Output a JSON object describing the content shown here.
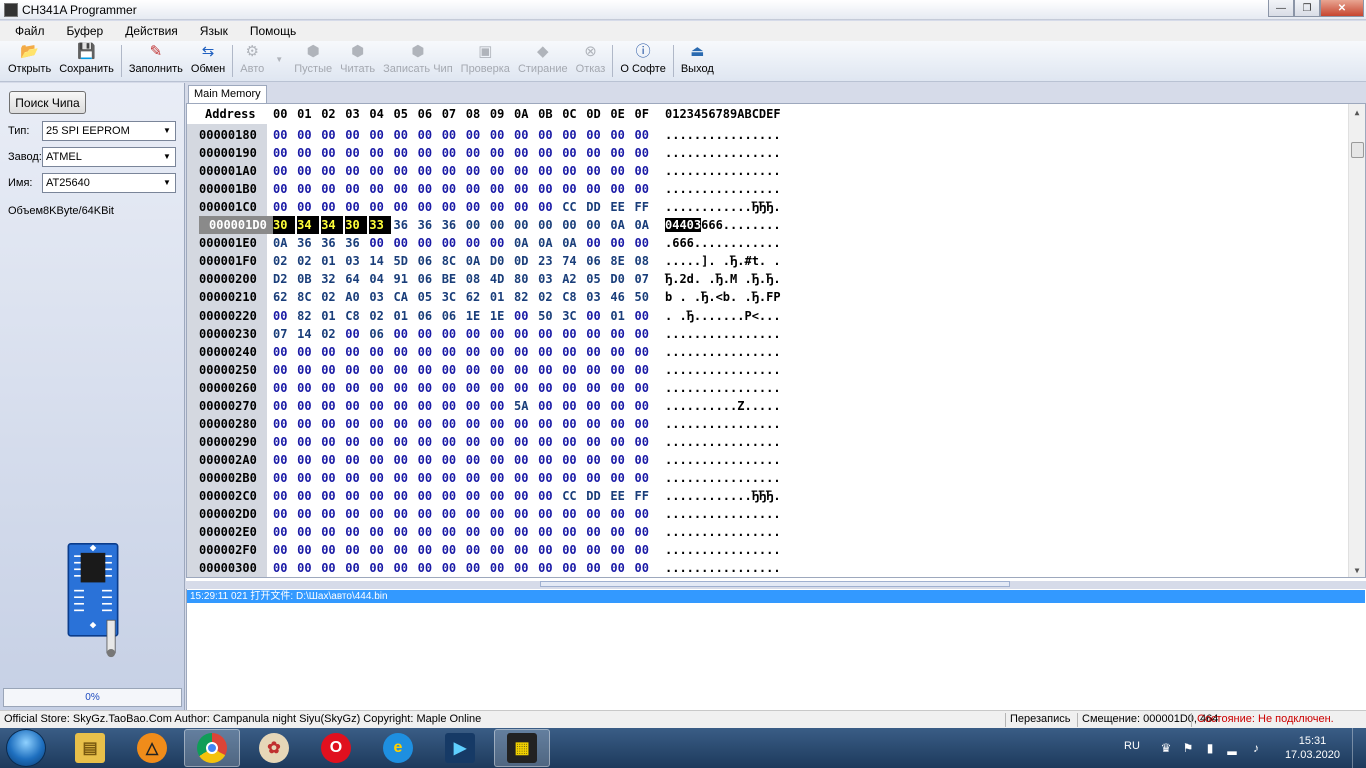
{
  "window": {
    "title": "CH341A Programmer",
    "minimize_label": "—",
    "maximize_label": "❐",
    "close_label": "✕"
  },
  "menu": {
    "items": [
      "Файл",
      "Буфер",
      "Действия",
      "Язык",
      "Помощь"
    ]
  },
  "toolbar": {
    "open": "Открыть",
    "save": "Сохранить",
    "fill": "Заполнить",
    "swap": "Обмен",
    "auto": "Авто",
    "blank": "Пустые",
    "read": "Читать",
    "write": "Записать Чип",
    "verify": "Проверка",
    "erase": "Стирание",
    "cancel": "Отказ",
    "about": "О Софте",
    "exit": "Выход"
  },
  "left_panel": {
    "search_button": "Поиск Чипа",
    "type_label": "Тип:",
    "type_value": "25 SPI EEPROM",
    "vendor_label": "Завод:",
    "vendor_value": "ATMEL",
    "name_label": "Имя:",
    "name_value": "AT25640",
    "capacity": "Объем8KByte/64KBit",
    "progress": "0%"
  },
  "hex": {
    "tab": "Main Memory",
    "address_header": "Address",
    "column_headers": [
      "00",
      "01",
      "02",
      "03",
      "04",
      "05",
      "06",
      "07",
      "08",
      "09",
      "0A",
      "0B",
      "0C",
      "0D",
      "0E",
      "0F"
    ],
    "ascii_header": "0123456789ABCDEF",
    "rows": [
      {
        "addr": "00000180",
        "bytes": [
          "00",
          "00",
          "00",
          "00",
          "00",
          "00",
          "00",
          "00",
          "00",
          "00",
          "00",
          "00",
          "00",
          "00",
          "00",
          "00"
        ],
        "ascii": "................"
      },
      {
        "addr": "00000190",
        "bytes": [
          "00",
          "00",
          "00",
          "00",
          "00",
          "00",
          "00",
          "00",
          "00",
          "00",
          "00",
          "00",
          "00",
          "00",
          "00",
          "00"
        ],
        "ascii": "................"
      },
      {
        "addr": "000001A0",
        "bytes": [
          "00",
          "00",
          "00",
          "00",
          "00",
          "00",
          "00",
          "00",
          "00",
          "00",
          "00",
          "00",
          "00",
          "00",
          "00",
          "00"
        ],
        "ascii": "................"
      },
      {
        "addr": "000001B0",
        "bytes": [
          "00",
          "00",
          "00",
          "00",
          "00",
          "00",
          "00",
          "00",
          "00",
          "00",
          "00",
          "00",
          "00",
          "00",
          "00",
          "00"
        ],
        "ascii": "................"
      },
      {
        "addr": "000001C0",
        "bytes": [
          "00",
          "00",
          "00",
          "00",
          "00",
          "00",
          "00",
          "00",
          "00",
          "00",
          "00",
          "00",
          "CC",
          "DD",
          "EE",
          "FF"
        ],
        "ascii": "............ЂЂЂ."
      },
      {
        "addr": "000001D0",
        "bytes": [
          "30",
          "34",
          "34",
          "30",
          "33",
          "36",
          "36",
          "36",
          "00",
          "00",
          "00",
          "00",
          "00",
          "00",
          "0A",
          "0A"
        ],
        "ascii": "04403666........",
        "selected": true
      },
      {
        "addr": "000001E0",
        "bytes": [
          "0A",
          "36",
          "36",
          "36",
          "00",
          "00",
          "00",
          "00",
          "00",
          "00",
          "0A",
          "0A",
          "0A",
          "00",
          "00",
          "00"
        ],
        "ascii": ".666............"
      },
      {
        "addr": "000001F0",
        "bytes": [
          "02",
          "02",
          "01",
          "03",
          "14",
          "5D",
          "06",
          "8C",
          "0A",
          "D0",
          "0D",
          "23",
          "74",
          "06",
          "8E",
          "08"
        ],
        "ascii": ".....]. .Ђ.#t. ."
      },
      {
        "addr": "00000200",
        "bytes": [
          "D2",
          "0B",
          "32",
          "64",
          "04",
          "91",
          "06",
          "BE",
          "08",
          "4D",
          "80",
          "03",
          "A2",
          "05",
          "D0",
          "07"
        ],
        "ascii": "Ђ.2d. .Ђ.M .Ђ.Ђ."
      },
      {
        "addr": "00000210",
        "bytes": [
          "62",
          "8C",
          "02",
          "A0",
          "03",
          "CA",
          "05",
          "3C",
          "62",
          "01",
          "82",
          "02",
          "C8",
          "03",
          "46",
          "50"
        ],
        "ascii": "b . .Ђ.<b. .Ђ.FP"
      },
      {
        "addr": "00000220",
        "bytes": [
          "00",
          "82",
          "01",
          "C8",
          "02",
          "01",
          "06",
          "06",
          "1E",
          "1E",
          "00",
          "50",
          "3C",
          "00",
          "01",
          "00"
        ],
        "ascii": ". .Ђ.......P<..."
      },
      {
        "addr": "00000230",
        "bytes": [
          "07",
          "14",
          "02",
          "00",
          "06",
          "00",
          "00",
          "00",
          "00",
          "00",
          "00",
          "00",
          "00",
          "00",
          "00",
          "00"
        ],
        "ascii": "................"
      },
      {
        "addr": "00000240",
        "bytes": [
          "00",
          "00",
          "00",
          "00",
          "00",
          "00",
          "00",
          "00",
          "00",
          "00",
          "00",
          "00",
          "00",
          "00",
          "00",
          "00"
        ],
        "ascii": "................"
      },
      {
        "addr": "00000250",
        "bytes": [
          "00",
          "00",
          "00",
          "00",
          "00",
          "00",
          "00",
          "00",
          "00",
          "00",
          "00",
          "00",
          "00",
          "00",
          "00",
          "00"
        ],
        "ascii": "................"
      },
      {
        "addr": "00000260",
        "bytes": [
          "00",
          "00",
          "00",
          "00",
          "00",
          "00",
          "00",
          "00",
          "00",
          "00",
          "00",
          "00",
          "00",
          "00",
          "00",
          "00"
        ],
        "ascii": "................"
      },
      {
        "addr": "00000270",
        "bytes": [
          "00",
          "00",
          "00",
          "00",
          "00",
          "00",
          "00",
          "00",
          "00",
          "00",
          "5A",
          "00",
          "00",
          "00",
          "00",
          "00"
        ],
        "ascii": "..........Z....."
      },
      {
        "addr": "00000280",
        "bytes": [
          "00",
          "00",
          "00",
          "00",
          "00",
          "00",
          "00",
          "00",
          "00",
          "00",
          "00",
          "00",
          "00",
          "00",
          "00",
          "00"
        ],
        "ascii": "................"
      },
      {
        "addr": "00000290",
        "bytes": [
          "00",
          "00",
          "00",
          "00",
          "00",
          "00",
          "00",
          "00",
          "00",
          "00",
          "00",
          "00",
          "00",
          "00",
          "00",
          "00"
        ],
        "ascii": "................"
      },
      {
        "addr": "000002A0",
        "bytes": [
          "00",
          "00",
          "00",
          "00",
          "00",
          "00",
          "00",
          "00",
          "00",
          "00",
          "00",
          "00",
          "00",
          "00",
          "00",
          "00"
        ],
        "ascii": "................"
      },
      {
        "addr": "000002B0",
        "bytes": [
          "00",
          "00",
          "00",
          "00",
          "00",
          "00",
          "00",
          "00",
          "00",
          "00",
          "00",
          "00",
          "00",
          "00",
          "00",
          "00"
        ],
        "ascii": "................"
      },
      {
        "addr": "000002C0",
        "bytes": [
          "00",
          "00",
          "00",
          "00",
          "00",
          "00",
          "00",
          "00",
          "00",
          "00",
          "00",
          "00",
          "CC",
          "DD",
          "EE",
          "FF"
        ],
        "ascii": "............ЂЂЂ."
      },
      {
        "addr": "000002D0",
        "bytes": [
          "00",
          "00",
          "00",
          "00",
          "00",
          "00",
          "00",
          "00",
          "00",
          "00",
          "00",
          "00",
          "00",
          "00",
          "00",
          "00"
        ],
        "ascii": "................"
      },
      {
        "addr": "000002E0",
        "bytes": [
          "00",
          "00",
          "00",
          "00",
          "00",
          "00",
          "00",
          "00",
          "00",
          "00",
          "00",
          "00",
          "00",
          "00",
          "00",
          "00"
        ],
        "ascii": "................"
      },
      {
        "addr": "000002F0",
        "bytes": [
          "00",
          "00",
          "00",
          "00",
          "00",
          "00",
          "00",
          "00",
          "00",
          "00",
          "00",
          "00",
          "00",
          "00",
          "00",
          "00"
        ],
        "ascii": "................"
      },
      {
        "addr": "00000300",
        "bytes": [
          "00",
          "00",
          "00",
          "00",
          "00",
          "00",
          "00",
          "00",
          "00",
          "00",
          "00",
          "00",
          "00",
          "00",
          "00",
          "00"
        ],
        "ascii": "................"
      }
    ],
    "selected_ascii_prefix": "04403"
  },
  "log": {
    "line": "15:29:11 021 打开文件: D:\\Шах\\авто\\444.bin"
  },
  "status": {
    "store": "Official Store: SkyGz.TaoBao.Com Author: Campanula night Siyu(SkyGz) Copyright: Maple Online",
    "mode": "Перезапись",
    "offset": "Смещение: 000001D0, 464",
    "state": "Состояние: Не подключен.",
    "state_color": "#cc0000"
  },
  "taskbar": {
    "apps": [
      "explorer-icon",
      "avast-icon",
      "chrome-icon",
      "paint-icon",
      "opera-icon",
      "ie-icon",
      "media-icon",
      "ch341a-icon"
    ],
    "language": "RU",
    "time": "15:31",
    "date": "17.03.2020"
  }
}
